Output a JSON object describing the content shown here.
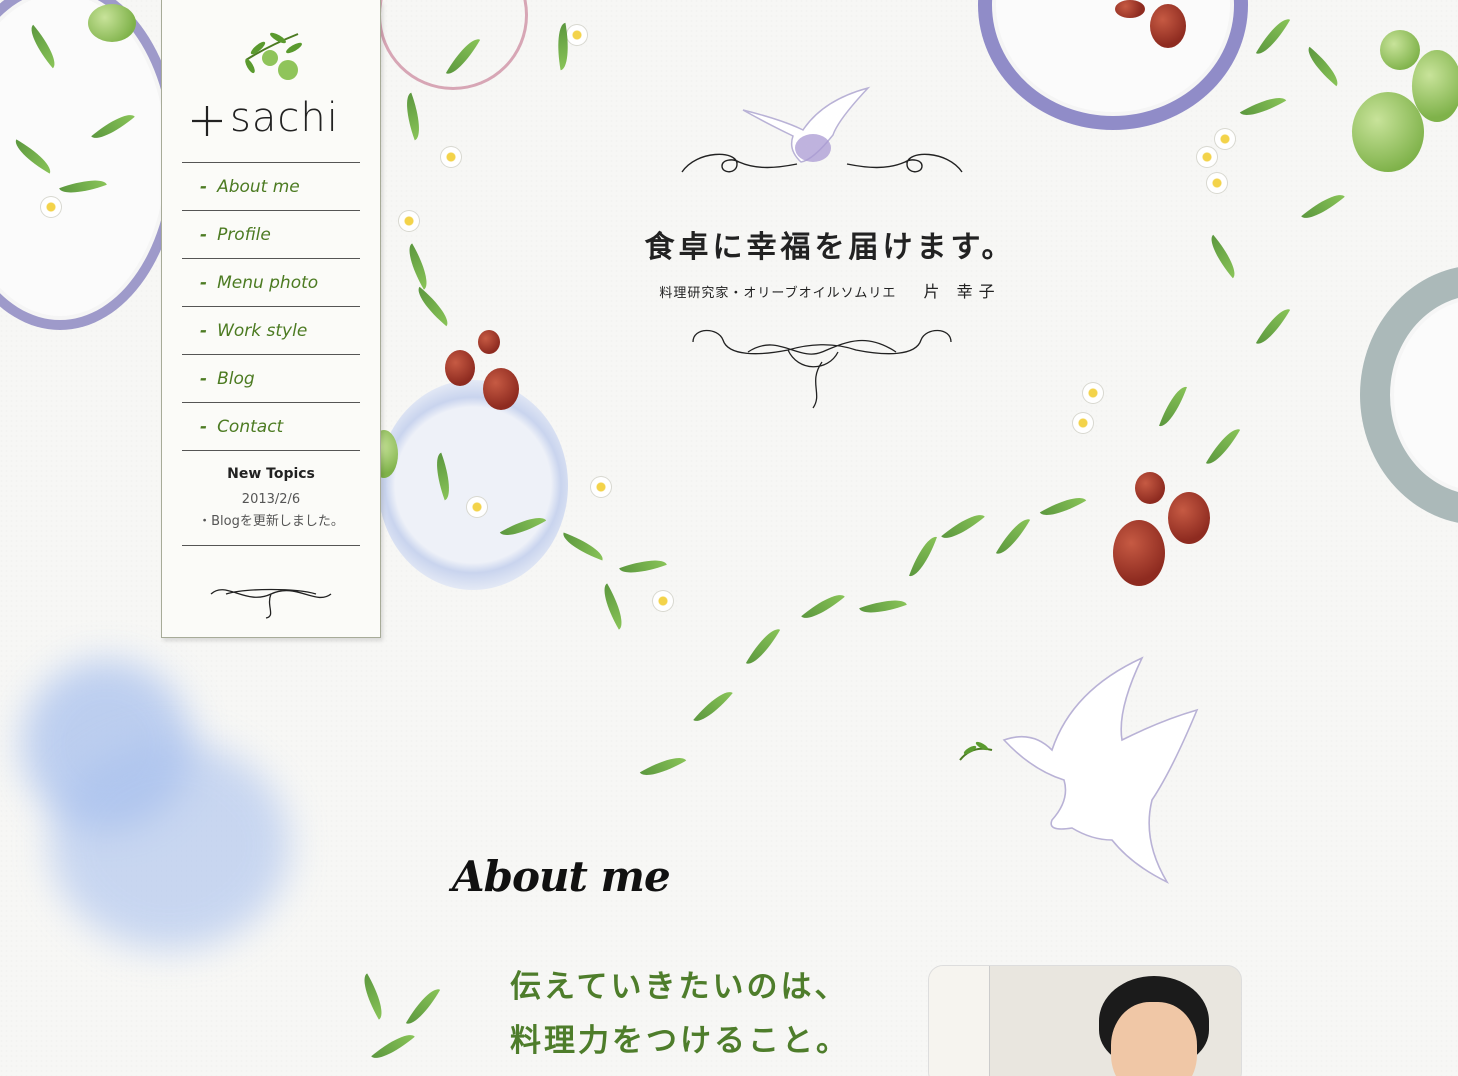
{
  "brand": {
    "logo_text": "sachi"
  },
  "nav": {
    "items": [
      {
        "label": "About me"
      },
      {
        "label": "Profile"
      },
      {
        "label": "Menu photo"
      },
      {
        "label": "Work style"
      },
      {
        "label": "Blog"
      },
      {
        "label": "Contact"
      }
    ],
    "dash": "-"
  },
  "topics": {
    "title": "New Topics",
    "date": "2013/2/6",
    "text": "・Blogを更新しました。"
  },
  "hero": {
    "title": "食卓に幸福を届けます。",
    "subtitle": "料理研究家・オリーブオイルソムリエ",
    "name": "片 幸子"
  },
  "about": {
    "heading": "About me",
    "lead_line1": "伝えていきたいのは、",
    "lead_line2": "料理力をつけること。"
  },
  "colors": {
    "accent_green": "#4e7d2b",
    "nav_green": "#4c7b22",
    "berry": "#8e2b20",
    "blob_blue": "#a9c1ee"
  },
  "icons": {
    "logo_mark": "cross-sparkle-icon",
    "logo_olive": "olive-branch-icon",
    "hero_dove": "dove-icon",
    "flourish": "flourish-ornament-icon"
  }
}
